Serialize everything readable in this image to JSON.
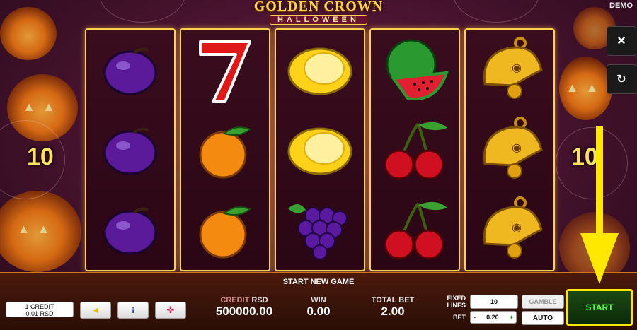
{
  "header": {
    "logo_line1": "GOLDEN CROWN",
    "logo_line2": "HALLOWEEN",
    "mode": "DEMO"
  },
  "side_buttons": {
    "close_icon": "×",
    "history_icon": "↻"
  },
  "line_markers": {
    "left": "10",
    "right": "10"
  },
  "reels": [
    [
      "plum",
      "plum",
      "plum"
    ],
    [
      "seven",
      "orange",
      "orange"
    ],
    [
      "lemon",
      "lemon",
      "grapes"
    ],
    [
      "watermelon",
      "cherries",
      "cherries"
    ],
    [
      "bell",
      "bell",
      "bell"
    ]
  ],
  "bottom": {
    "banner": "START NEW GAME",
    "credit_box": {
      "line1": "1 CREDIT",
      "line2": "0.01 RSD"
    },
    "sound_icon": "◀",
    "info_icon": "i",
    "fullscreen_icon": "✜",
    "credit": {
      "label": "CREDIT",
      "currency": "RSD",
      "value": "500000.00"
    },
    "win": {
      "label": "WIN",
      "value": "0.00"
    },
    "total_bet": {
      "label": "TOTAL BET",
      "value": "2.00"
    },
    "fixed_lines": {
      "label1": "FIXED",
      "label2": "LINES",
      "value": "10"
    },
    "bet": {
      "label": "BET",
      "minus": "-",
      "value": "0.20",
      "plus": "+"
    },
    "gamble_label": "GAMBLE",
    "auto_label": "AUTO",
    "start_label": "START"
  },
  "colors": {
    "accent_gold": "#ffd24a",
    "start_border": "#ffe800",
    "start_text": "#4cff3c"
  }
}
